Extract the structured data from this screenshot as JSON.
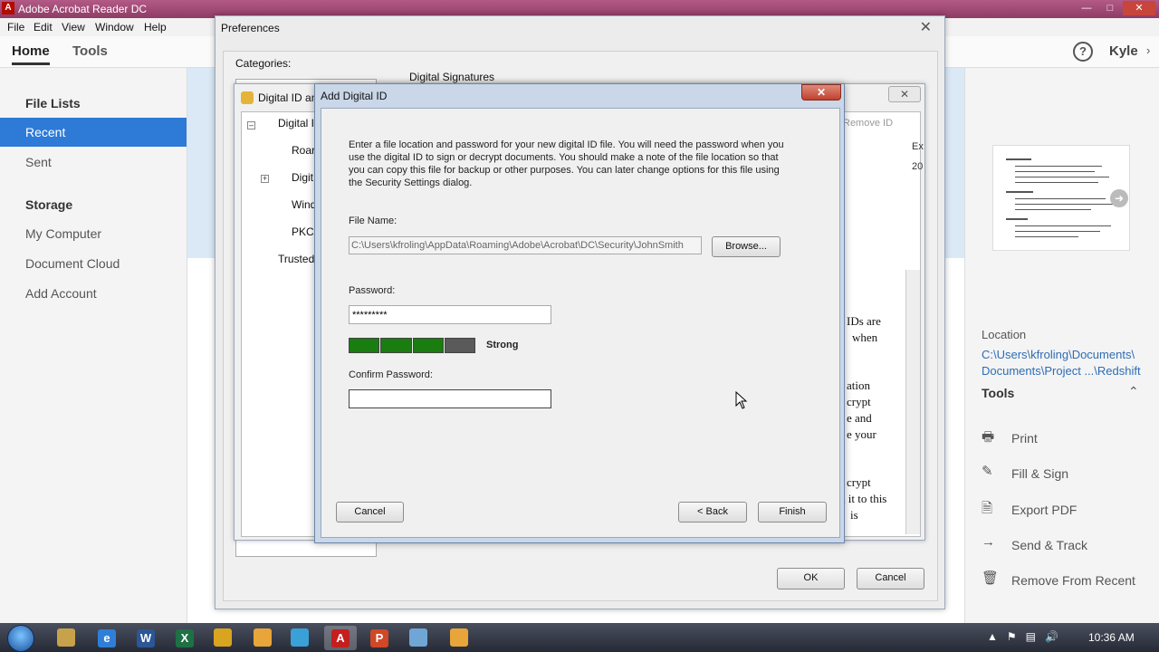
{
  "app": {
    "title": "Adobe Acrobat Reader DC",
    "icon_name": "acrobat-icon",
    "menu": [
      "File",
      "Edit",
      "View",
      "Window",
      "Help"
    ],
    "tabs": [
      "Home",
      "Tools"
    ],
    "user": "Kyle"
  },
  "left_nav": {
    "file_lists_heading": "File Lists",
    "items_files": [
      "Recent",
      "Sent"
    ],
    "storage_heading": "Storage",
    "items_storage": [
      "My Computer",
      "Document Cloud",
      "Add Account"
    ]
  },
  "right_panel": {
    "location_label": "Location",
    "location_path_line1": "C:\\Users\\kfroling\\Documents\\",
    "location_path_line2": "Documents\\Project ...\\Redshift",
    "tools_heading": "Tools",
    "tools": [
      {
        "label": "Print",
        "icon": "printer-icon"
      },
      {
        "label": "Fill & Sign",
        "icon": "pen-icon"
      },
      {
        "label": "Export PDF",
        "icon": "export-pdf-icon"
      },
      {
        "label": "Send & Track",
        "icon": "send-arrow-icon"
      },
      {
        "label": "Remove From Recent",
        "icon": "remove-document-icon"
      }
    ]
  },
  "preferences": {
    "title": "Preferences",
    "categories_label": "Categories:",
    "section_label": "Digital Signatures",
    "ok": "OK",
    "cancel": "Cancel"
  },
  "digital_id_config": {
    "title": "Digital ID an",
    "tree": [
      "Digital I",
      "Roar",
      "Digit",
      "Wind",
      "PKCS",
      "Trusted"
    ],
    "remove_id": "Remove ID",
    "col_ex": "Ex",
    "val_20": "20",
    "fragments": [
      "IDs are",
      "when",
      "ation",
      "crypt",
      "e and",
      "e your",
      "crypt",
      "d it to this",
      "is"
    ]
  },
  "add_digital_id": {
    "title": "Add Digital ID",
    "intro": "Enter a file location and password for your new digital ID file. You will need the password when you use the digital ID to sign or decrypt documents. You should make a note of the file location so that you can copy this file for backup or other purposes. You can later change options for this file using the Security Settings dialog.",
    "file_name_label": "File Name:",
    "file_name_value": "C:\\Users\\kfroling\\AppData\\Roaming\\Adobe\\Acrobat\\DC\\Security\\JohnSmith",
    "browse": "Browse...",
    "password_label": "Password:",
    "password_value": "*********",
    "strength_filled": 3,
    "strength_total": 4,
    "strength_text": "Strong",
    "strength_color": "#1a7d10",
    "strength_empty_color": "#5a5a5a",
    "confirm_label": "Confirm Password:",
    "confirm_value": "",
    "cancel": "Cancel",
    "back": "< Back",
    "finish": "Finish"
  },
  "taskbar": {
    "apps": [
      {
        "icon": "explorer-icon",
        "label": ""
      },
      {
        "icon": "ie-icon",
        "label": "e"
      },
      {
        "icon": "word-icon",
        "label": "W"
      },
      {
        "icon": "excel-icon",
        "label": "X"
      },
      {
        "icon": "chrome-icon",
        "label": ""
      },
      {
        "icon": "app-icon",
        "label": ""
      },
      {
        "icon": "globe-icon",
        "label": ""
      },
      {
        "icon": "acrobat-icon",
        "label": "A"
      },
      {
        "icon": "powerpoint-icon",
        "label": "P"
      },
      {
        "icon": "notepad-icon",
        "label": ""
      },
      {
        "icon": "app-icon",
        "label": ""
      }
    ],
    "tray_icons": [
      "action-center-icon",
      "network-icon",
      "volume-icon",
      "flag-icon"
    ],
    "clock": "10:36 AM"
  }
}
